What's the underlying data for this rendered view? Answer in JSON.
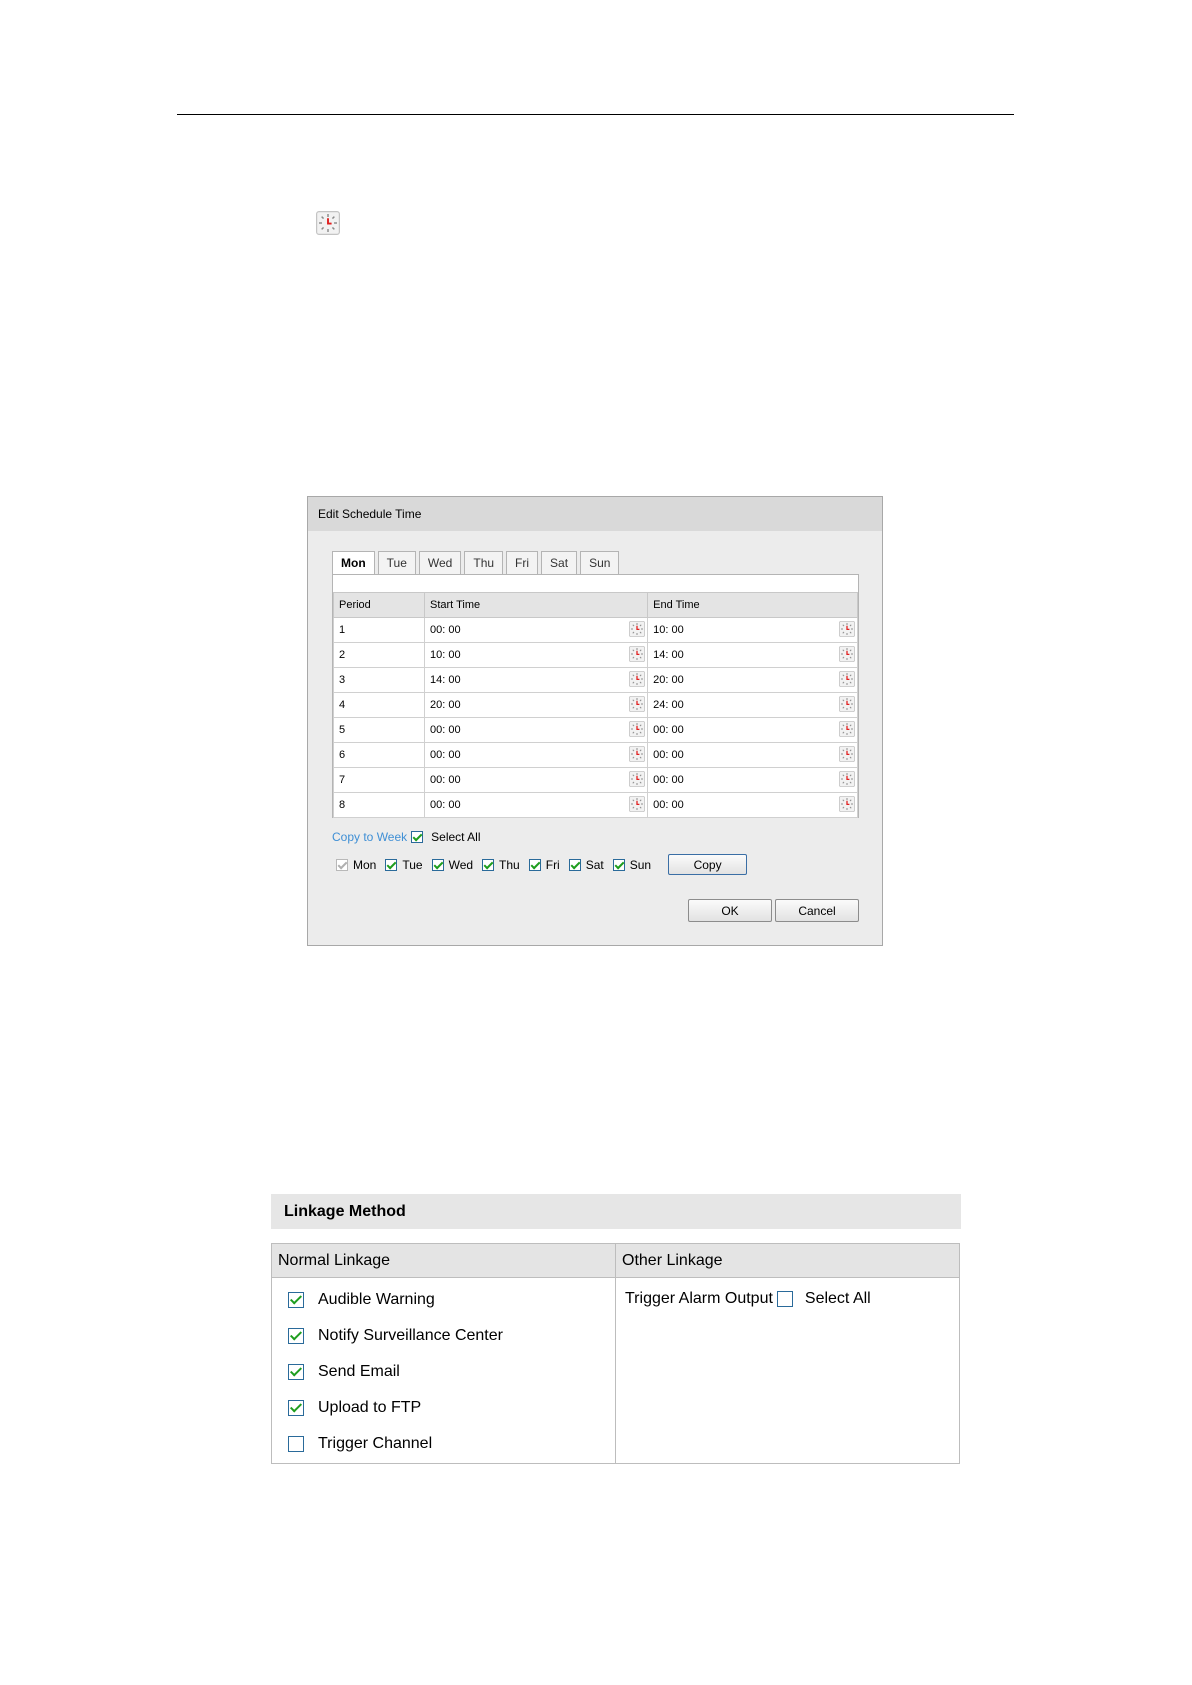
{
  "schedule_dialog": {
    "title": "Edit Schedule Time",
    "tabs": [
      "Mon",
      "Tue",
      "Wed",
      "Thu",
      "Fri",
      "Sat",
      "Sun"
    ],
    "active_tab": "Mon",
    "headers": {
      "period": "Period",
      "start": "Start Time",
      "end": "End Time"
    },
    "rows": [
      {
        "period": "1",
        "start": "00: 00",
        "end": "10: 00"
      },
      {
        "period": "2",
        "start": "10: 00",
        "end": "14: 00"
      },
      {
        "period": "3",
        "start": "14: 00",
        "end": "20: 00"
      },
      {
        "period": "4",
        "start": "20: 00",
        "end": "24: 00"
      },
      {
        "period": "5",
        "start": "00: 00",
        "end": "00: 00"
      },
      {
        "period": "6",
        "start": "00: 00",
        "end": "00: 00"
      },
      {
        "period": "7",
        "start": "00: 00",
        "end": "00: 00"
      },
      {
        "period": "8",
        "start": "00: 00",
        "end": "00: 00"
      }
    ],
    "copy_to_week": "Copy to Week",
    "select_all": "Select All",
    "select_all_checked": true,
    "days": [
      {
        "label": "Mon",
        "checked": true,
        "disabled": true
      },
      {
        "label": "Tue",
        "checked": true,
        "disabled": false
      },
      {
        "label": "Wed",
        "checked": true,
        "disabled": false
      },
      {
        "label": "Thu",
        "checked": true,
        "disabled": false
      },
      {
        "label": "Fri",
        "checked": true,
        "disabled": false
      },
      {
        "label": "Sat",
        "checked": true,
        "disabled": false
      },
      {
        "label": "Sun",
        "checked": true,
        "disabled": false
      }
    ],
    "copy_button": "Copy",
    "ok_button": "OK",
    "cancel_button": "Cancel"
  },
  "linkage": {
    "title": "Linkage Method",
    "normal_header": "Normal Linkage",
    "other_header": "Other Linkage",
    "normal_items": [
      {
        "label": "Audible Warning",
        "checked": true
      },
      {
        "label": "Notify Surveillance Center",
        "checked": true
      },
      {
        "label": "Send Email",
        "checked": true
      },
      {
        "label": "Upload to FTP",
        "checked": true
      },
      {
        "label": "Trigger Channel",
        "checked": false
      }
    ],
    "trigger_alarm_output": "Trigger Alarm Output",
    "trigger_checked": false,
    "select_all": "Select All"
  },
  "colors": {
    "link": "#3f8fd5",
    "check": "#1e9d1e",
    "clock_hand": "#e02020"
  }
}
